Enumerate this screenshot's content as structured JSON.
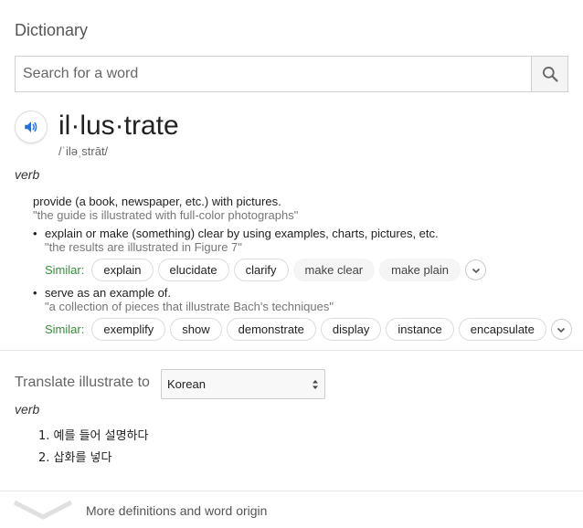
{
  "card": {
    "title": "Dictionary"
  },
  "search": {
    "placeholder": "Search for a word",
    "value": ""
  },
  "entry": {
    "headword": "il·lus·trate",
    "phonetic": "/ˈiləˌstrāt/",
    "part_of_speech": "verb",
    "definitions": [
      {
        "text": "provide (a book, newspaper, etc.) with pictures.",
        "example": "\"the guide is illustrated with full-color photographs\""
      },
      {
        "text": "explain or make (something) clear by using examples, charts, pictures, etc.",
        "example": "\"the results are illustrated in Figure 7\"",
        "similar_label": "Similar:",
        "similar": [
          "explain",
          "elucidate",
          "clarify",
          "make clear",
          "make plain"
        ]
      },
      {
        "text": "serve as an example of.",
        "example": "\"a collection of pieces that illustrate Bach's techniques\"",
        "similar_label": "Similar:",
        "similar": [
          "exemplify",
          "show",
          "demonstrate",
          "display",
          "instance",
          "encapsulate"
        ]
      }
    ]
  },
  "translate": {
    "label": "Translate illustrate to",
    "selected_language": "Korean",
    "part_of_speech": "verb",
    "items": [
      "1. 예를 들어 설명하다",
      "2. 삽화를 넣다"
    ]
  },
  "footer": {
    "more_label": "More definitions and word origin"
  },
  "colors": {
    "similar_label": "#388e3c",
    "speaker_icon": "#1a73e8",
    "chip_border": "#dadce0"
  },
  "icons": {
    "search": "search-icon",
    "speaker": "speaker-icon",
    "expand": "chevron-down-icon",
    "more": "chevron-down-icon"
  }
}
